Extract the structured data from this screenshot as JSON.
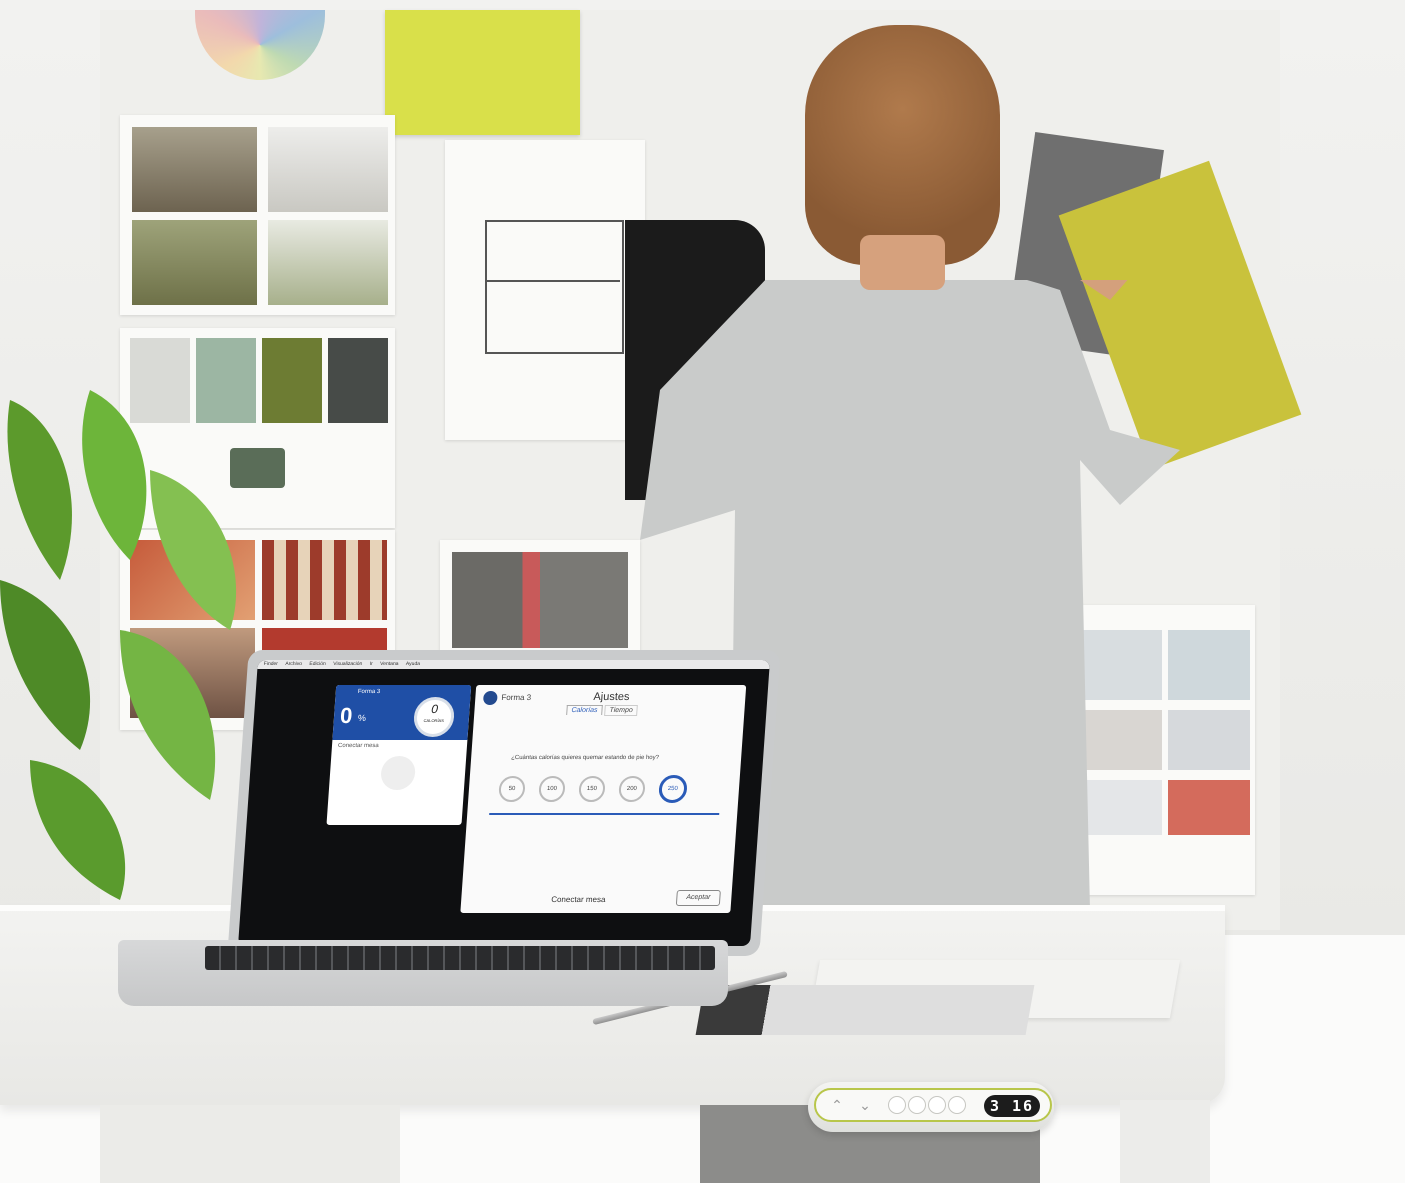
{
  "laptop_app": {
    "menubar_items": [
      "Finder",
      "Archivo",
      "Edición",
      "Visualización",
      "Ir",
      "Ventana",
      "Ayuda"
    ],
    "small_window": {
      "brand": "Forma 3",
      "percent_value": "0",
      "percent_unit": "%",
      "calorias_value": "0",
      "calorias_label": "CALORÍAS",
      "conectar_label": "Conectar mesa"
    },
    "settings_window": {
      "brand": "Forma 3",
      "title": "Ajustes",
      "tabs": [
        "Calorías",
        "Tiempo"
      ],
      "question": "¿Cuántas calorías quieres quemar estando de pie hoy?",
      "calorie_options": [
        "50",
        "100",
        "150",
        "200",
        "250"
      ],
      "selected_option": "250",
      "connect_label": "Conectar mesa",
      "accept_label": "Aceptar"
    }
  },
  "desk_panel": {
    "display_value": "3 16"
  },
  "colors": {
    "app_blue": "#1f4fa6",
    "panel_accent": "#b8c64a"
  }
}
